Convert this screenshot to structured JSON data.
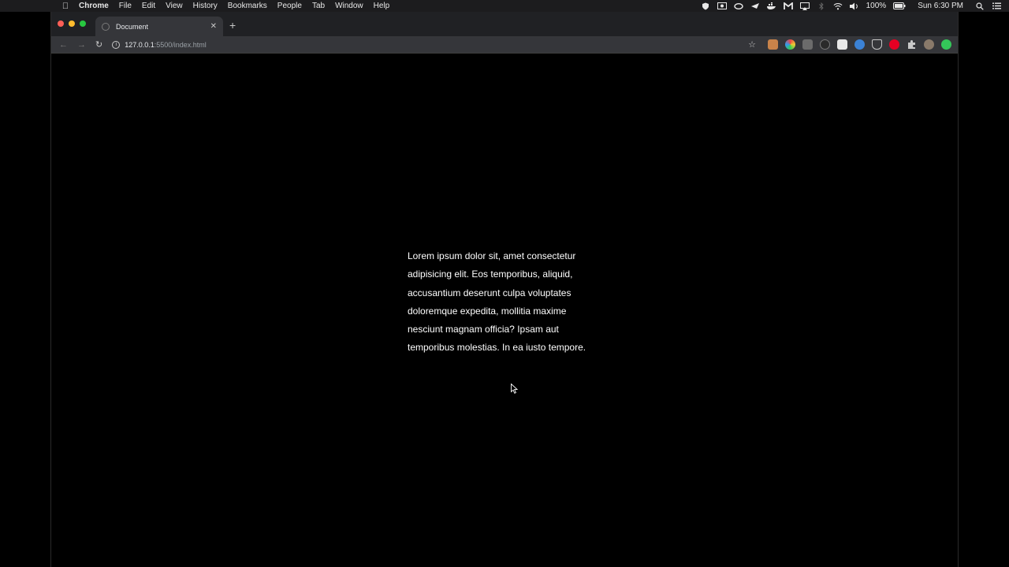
{
  "menubar": {
    "app_name": "Chrome",
    "items": [
      "File",
      "Edit",
      "View",
      "History",
      "Bookmarks",
      "People",
      "Tab",
      "Window",
      "Help"
    ],
    "battery": "100%",
    "clock": "Sun 6:30 PM"
  },
  "browser": {
    "tab_title": "Document",
    "url_host": "127.0.0.1",
    "url_path": ":5500/index.html"
  },
  "page": {
    "paragraph": "Lorem ipsum dolor sit, amet consectetur adipisicing elit. Eos temporibus, aliquid, accusantium deserunt culpa voluptates doloremque expedita, mollitia maxime nesciunt magnam officia? Ipsam aut temporibus molestias. In ea iusto tempore."
  },
  "icons": {
    "status": [
      "shield-icon",
      "screen-record-icon",
      "creative-cloud-icon",
      "paper-plane-icon",
      "docker-icon",
      "malwarebytes-icon",
      "airplay-icon",
      "bluetooth-icon",
      "wifi-icon",
      "volume-icon",
      "battery-icon",
      "search-icon",
      "list-icon"
    ],
    "extensions": [
      "extension-orange-icon",
      "extension-color-picker-icon",
      "extension-grey-icon",
      "extension-dark-icon",
      "extension-white-icon",
      "extension-blue-icon",
      "pocket-icon",
      "pinterest-icon",
      "puzzle-icon",
      "profile-avatar-icon",
      "extension-green-icon"
    ]
  },
  "colors": {
    "close": "#ff5f57",
    "minimize": "#febc2e",
    "maximize": "#28c840",
    "pinterest": "#e60023",
    "green_ext": "#34c759"
  }
}
